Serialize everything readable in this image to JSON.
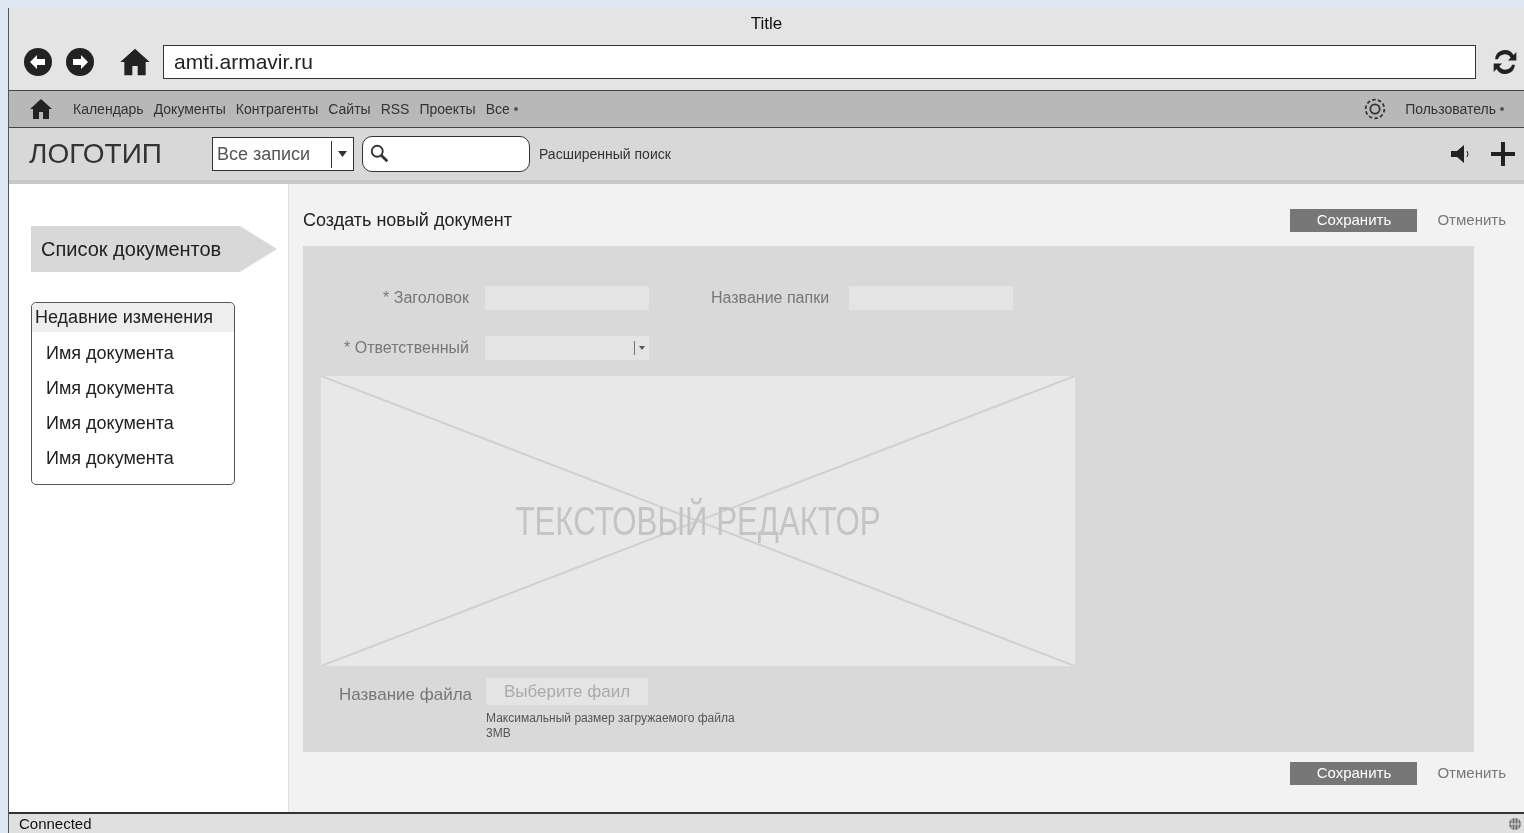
{
  "window": {
    "title": "Title"
  },
  "address_bar": {
    "value": "amti.armavir.ru"
  },
  "nav_menu": {
    "items": [
      {
        "label": "Календарь"
      },
      {
        "label": "Документы"
      },
      {
        "label": "Контрагенты"
      },
      {
        "label": "Сайты"
      },
      {
        "label": "RSS"
      },
      {
        "label": "Проекты"
      },
      {
        "label": "Все",
        "kind": "dropdown"
      }
    ],
    "user": "Пользователь"
  },
  "toolbar": {
    "logo": "ЛОГОТИП",
    "filter": "Все записи",
    "advanced_search": "Расширенный поиск"
  },
  "sidebar": {
    "heading": "Список документов",
    "recent": {
      "title": "Недавние изменения",
      "items": [
        "Имя документа",
        "Имя документа",
        "Имя документа",
        "Имя документа"
      ]
    }
  },
  "form": {
    "title": "Создать новый документ",
    "save": "Сохранить",
    "cancel": "Отменить",
    "fields": [
      {
        "label": "* Заголовок",
        "kind": "text"
      },
      {
        "label": "Название папки",
        "kind": "text"
      },
      {
        "label": "* Ответственный",
        "kind": "select"
      }
    ],
    "editor": "ТЕКСТОВЫЙ РЕДАКТОР",
    "file": {
      "label": "Название файла",
      "button": "Выберите фаил",
      "hint": "Максимальный размер загружаемого файла 3MB"
    },
    "bottom_save": "Сохранить",
    "bottom_cancel": "Отменить"
  },
  "status_bar": {
    "text": "Connected"
  }
}
